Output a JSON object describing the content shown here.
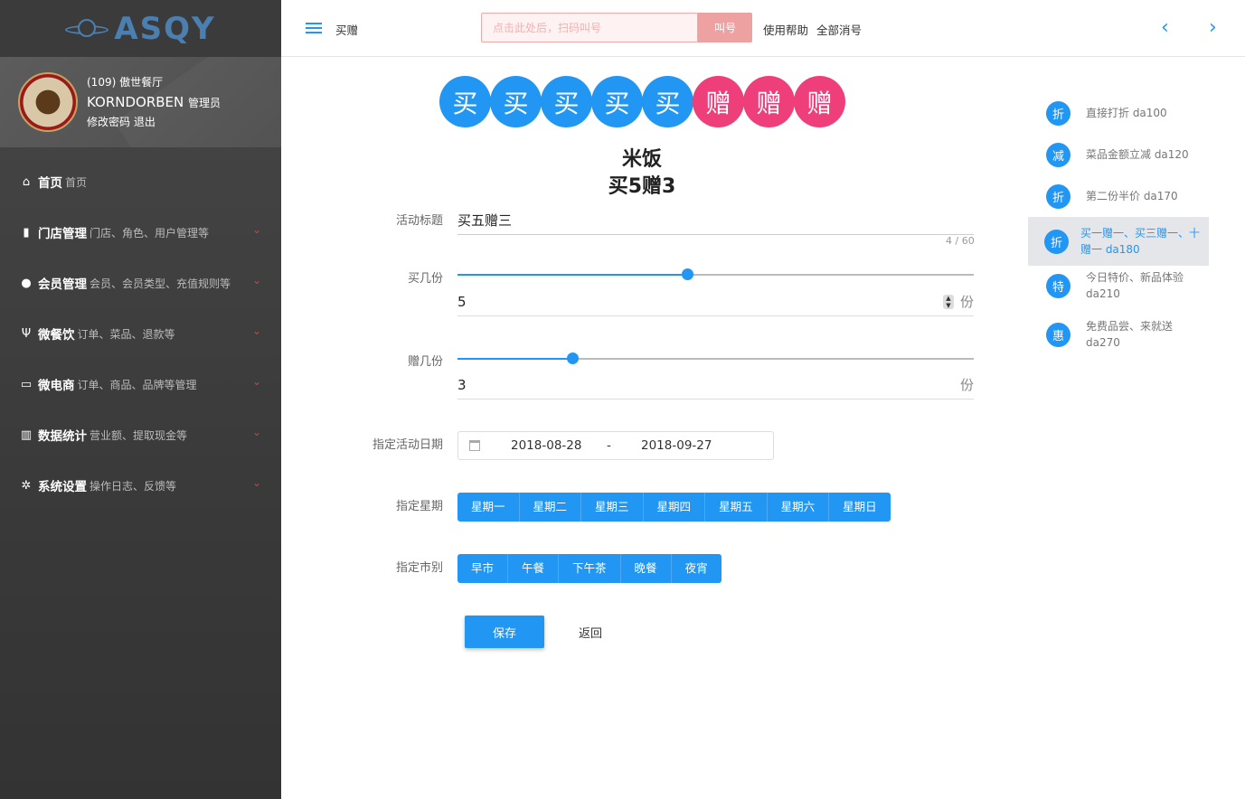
{
  "logo": {
    "text": "ASQY"
  },
  "profile": {
    "store": "(109) 傲世餐厅",
    "username": "KORNDORBEN",
    "role": "管理员",
    "change_password": "修改密码",
    "logout": "退出"
  },
  "sidebar": {
    "items": [
      {
        "icon": "home-icon",
        "glyph": "⌂",
        "title": "首页",
        "sub": "首页"
      },
      {
        "icon": "map-icon",
        "glyph": "▮",
        "title": "门店管理",
        "sub": "门店、角色、用户管理等"
      },
      {
        "icon": "comments-icon",
        "glyph": "●",
        "title": "会员管理",
        "sub": "会员、会员类型、充值规则等"
      },
      {
        "icon": "cutlery-icon",
        "glyph": "Ψ",
        "title": "微餐饮",
        "sub": "订单、菜品、退款等"
      },
      {
        "icon": "keyboard-icon",
        "glyph": "▭",
        "title": "微电商",
        "sub": "订单、商品、品牌等管理"
      },
      {
        "icon": "bar-chart-icon",
        "glyph": "▥",
        "title": "数据统计",
        "sub": "营业额、提取现金等"
      },
      {
        "icon": "cogs-icon",
        "glyph": "✲",
        "title": "系统设置",
        "sub": "操作日志、反馈等"
      }
    ]
  },
  "header": {
    "page_name": "买赠",
    "search_placeholder": "点击此处后，扫码叫号",
    "call_button": "叫号",
    "help_link": "使用帮助",
    "clear_link": "全部消号",
    "prev_glyph": "‹",
    "next_glyph": "›"
  },
  "promo": {
    "buy_char": "买",
    "give_char": "赠",
    "buy_count": 5,
    "give_count": 3,
    "product_name": "米饭",
    "summary": "买5赠3",
    "colors": {
      "buy": "#2196f3",
      "give": "#ee3f7a"
    }
  },
  "form": {
    "title_label": "活动标题",
    "title_value": "买五赠三",
    "title_counter": "4 / 60",
    "buy_label": "买几份",
    "buy_value": "5",
    "buy_slider_fraction": 0.444,
    "give_label": "赠几份",
    "give_value": "3",
    "give_slider_fraction": 0.222,
    "unit": "份",
    "date_label": "指定活动日期",
    "date_start": "2018-08-28",
    "date_sep": "-",
    "date_end": "2018-09-27",
    "weekday_label": "指定星期",
    "weekdays": [
      "星期一",
      "星期二",
      "星期三",
      "星期四",
      "星期五",
      "星期六",
      "星期日"
    ],
    "period_label": "指定市别",
    "periods": [
      "早市",
      "午餐",
      "下午茶",
      "晚餐",
      "夜宵"
    ],
    "save_button": "保存",
    "back_button": "返回"
  },
  "right_panel": {
    "items": [
      {
        "badge": "折",
        "text": "直接打折 da100",
        "active": false
      },
      {
        "badge": "减",
        "text": "菜品金额立减 da120",
        "active": false
      },
      {
        "badge": "折",
        "text": "第二份半价 da170",
        "active": false
      },
      {
        "badge": "折",
        "text": "买一赠一、买三赠一、十赠一 da180",
        "active": true
      },
      {
        "badge": "特",
        "text": "今日特价、新品体验 da210",
        "active": false
      },
      {
        "badge": "惠",
        "text": "免费品尝、来就送 da270",
        "active": false
      }
    ]
  }
}
